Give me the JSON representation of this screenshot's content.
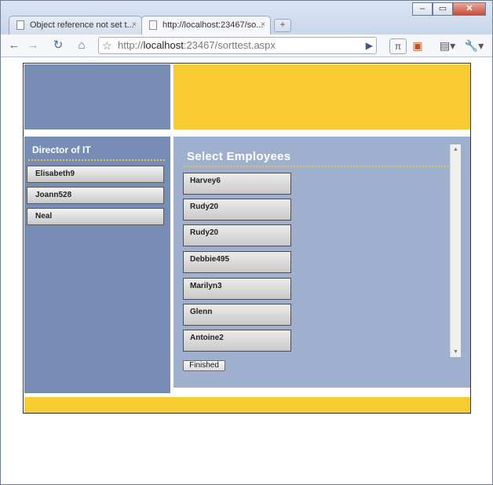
{
  "browser": {
    "tabs": [
      {
        "title": "Object reference not set t...",
        "close": "×",
        "active": false
      },
      {
        "title": "http://localhost:23467/so...",
        "close": "×",
        "active": true
      }
    ],
    "new_tab": "+",
    "window_controls": {
      "minimize": "–",
      "maximize": "▭",
      "close": "✕"
    },
    "toolbar": {
      "back": "←",
      "forward": "→",
      "reload": "↻",
      "home": "⌂",
      "star": "☆",
      "url_prefix": "http://",
      "url_host": "localhost",
      "url_rest": ":23467/sorttest.aspx",
      "go": "▶",
      "ext1": "π",
      "ext2": "▣",
      "page_menu": "▤▾",
      "tools_menu": "🔧▾"
    }
  },
  "page": {
    "sidebar": {
      "title": "Director of IT",
      "items": [
        "Elisabeth9",
        "Joann528",
        "Neal"
      ]
    },
    "main": {
      "title": "Select Employees",
      "employees": [
        "Harvey6",
        "Rudy20",
        "Rudy20",
        "Debbie495",
        "Marilyn3",
        "Glenn",
        "Antoine2"
      ],
      "finished_label": "Finished",
      "scroll_up": "▲",
      "scroll_down": "▼"
    }
  },
  "colors": {
    "header_blue": "#778db5",
    "header_yellow": "#f8cb33",
    "panel_light": "#9fb0cf",
    "rule_gold": "#e5c24a"
  }
}
